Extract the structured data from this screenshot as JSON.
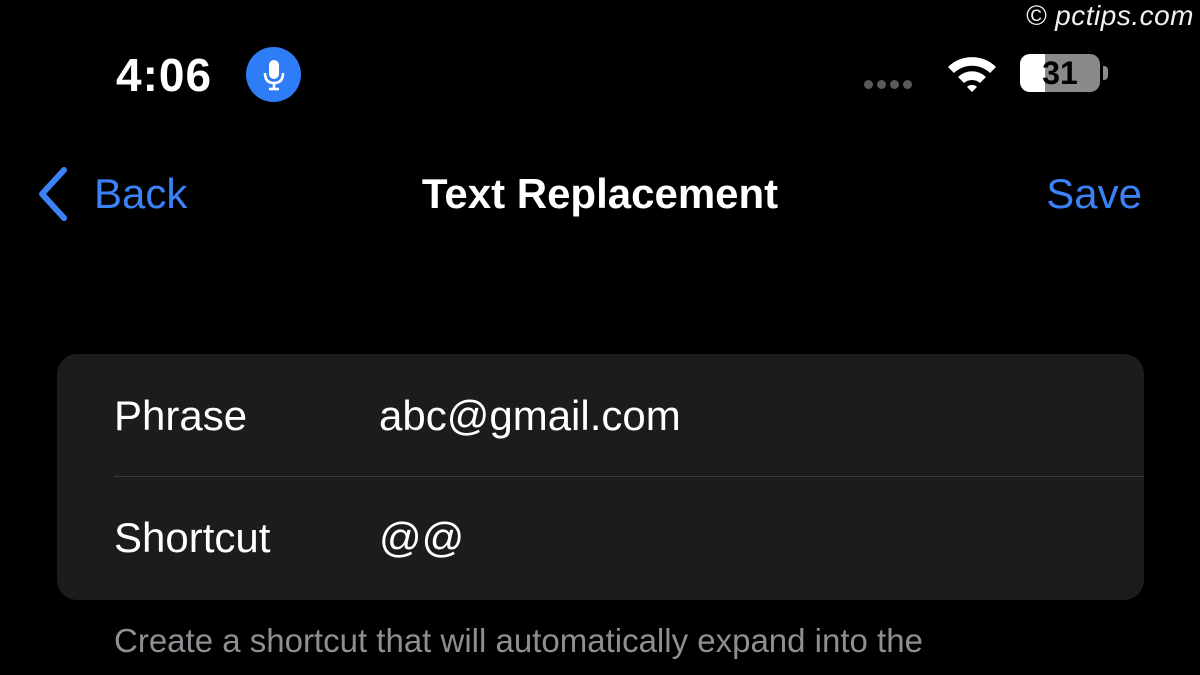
{
  "watermark": "© pctips.com",
  "status_bar": {
    "time": "4:06",
    "mic_icon": "microphone-icon",
    "battery_level": "31",
    "battery_fraction": 0.31,
    "accent_color": "#2f7df6"
  },
  "nav": {
    "back_label": "Back",
    "title": "Text Replacement",
    "save_label": "Save",
    "link_color": "#3b82f6"
  },
  "form": {
    "phrase_label": "Phrase",
    "phrase_value": "abc@gmail.com",
    "shortcut_label": "Shortcut",
    "shortcut_value": "@@"
  },
  "footnote": "Create a shortcut that will automatically expand into the"
}
